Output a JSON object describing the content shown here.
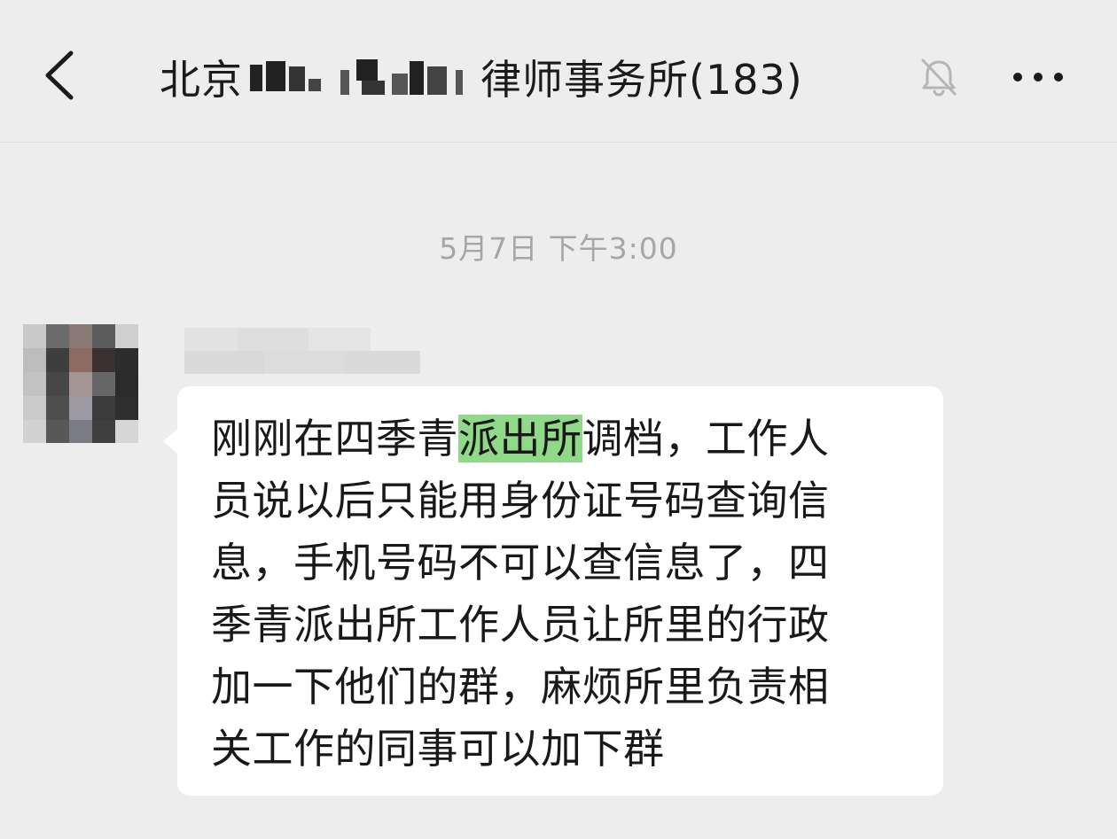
{
  "header": {
    "title_prefix": "北京",
    "title_suffix": "律师事务所(183)",
    "back_icon": "chevron-left-icon",
    "mute_icon": "bell-off-icon",
    "more_icon": "ellipsis-icon"
  },
  "chat": {
    "timestamp": "5月7日 下午3:00",
    "message": {
      "lines": [
        {
          "before": "刚刚在四季青",
          "highlight": "派出所",
          "after": "调档，工作人"
        },
        "员说以后只能用身份证号码查询信",
        "息，手机号码不可以查信息了，四",
        "季青派出所工作人员让所里的行政",
        "加一下他们的群，麻烦所里负责相",
        "关工作的同事可以加下群"
      ]
    }
  },
  "colors": {
    "background": "#ededed",
    "bubble": "#ffffff",
    "highlight": "#90d989",
    "timestamp": "#a6a6a6"
  }
}
